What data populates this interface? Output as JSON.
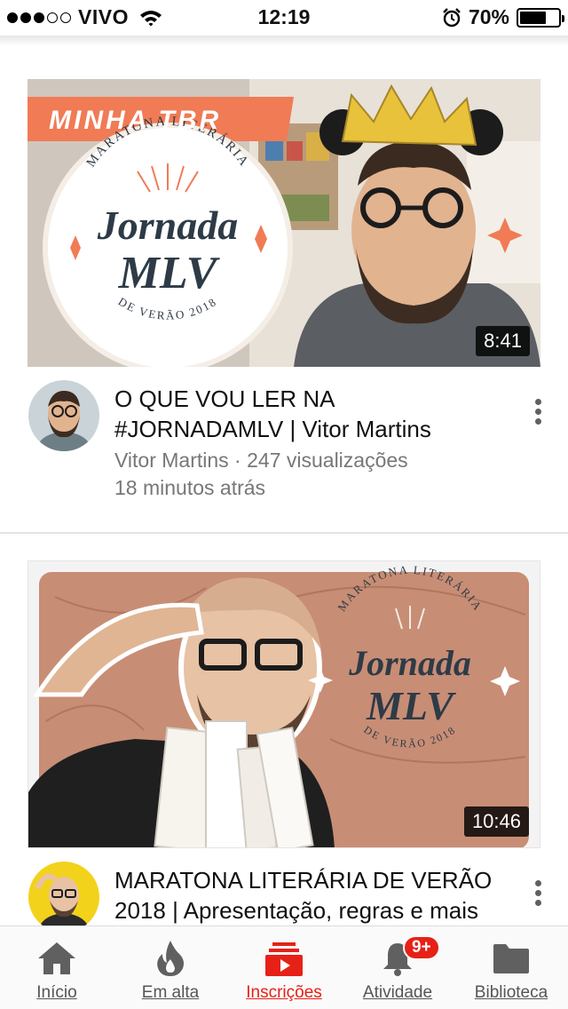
{
  "status_bar": {
    "carrier": "VIVO",
    "time": "12:19",
    "battery_percent": "70%",
    "battery_level": 0.7,
    "signal_bars_filled": 3,
    "signal_bars_total": 5
  },
  "videos": [
    {
      "title": "O QUE VOU LER NA #JORNADAMLV | Vitor Martins",
      "channel_meta": "Vitor Martins · 247 visualizações",
      "time_ago": "18 minutos atrás",
      "duration": "8:41",
      "thumbnail_text": {
        "banner": "MINHA TBR",
        "arc_top": "MARATONA LITERÁRIA",
        "logo_line1": "Jornada",
        "logo_line2": "MLV",
        "arc_bottom": "DE VERÃO 2018"
      }
    },
    {
      "title": "MARATONA LITERÁRIA DE VERÃO 2018 | Apresentação, regras e mais",
      "duration": "10:46",
      "thumbnail_text": {
        "arc_top": "MARATONA LITERÁRIA",
        "logo_line1": "Jornada",
        "logo_line2": "MLV",
        "arc_bottom": "DE VERÃO 2018"
      }
    }
  ],
  "bottom_nav": {
    "items": [
      {
        "label": "Início",
        "icon": "home-icon"
      },
      {
        "label": "Em alta",
        "icon": "flame-icon"
      },
      {
        "label": "Inscrições",
        "icon": "subscriptions-icon",
        "active": true
      },
      {
        "label": "Atividade",
        "icon": "bell-icon",
        "badge": "9+"
      },
      {
        "label": "Biblioteca",
        "icon": "folder-icon"
      }
    ]
  },
  "colors": {
    "accent": "#e62117",
    "meta_text": "#777777",
    "nav_text": "#555555",
    "banner_orange": "#f07b55",
    "logo_dark": "#2e3b47"
  }
}
